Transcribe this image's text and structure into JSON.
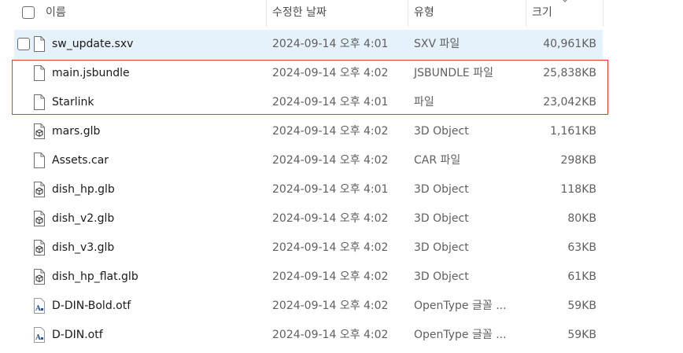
{
  "header": {
    "name_label": "이름",
    "date_label": "수정한 날짜",
    "type_label": "유형",
    "size_label": "크기"
  },
  "files": [
    {
      "name": "sw_update.sxv",
      "date": "2024-09-14 오후 4:01",
      "type": "SXV 파일",
      "size": "40,961KB",
      "icon": "file-icon",
      "selected": true
    },
    {
      "name": "main.jsbundle",
      "date": "2024-09-14 오후 4:02",
      "type": "JSBUNDLE 파일",
      "size": "25,838KB",
      "icon": "file-icon"
    },
    {
      "name": "Starlink",
      "date": "2024-09-14 오후 4:01",
      "type": "파일",
      "size": "23,042KB",
      "icon": "file-icon"
    },
    {
      "name": "mars.glb",
      "date": "2024-09-14 오후 4:02",
      "type": "3D Object",
      "size": "1,161KB",
      "icon": "3d-object-icon"
    },
    {
      "name": "Assets.car",
      "date": "2024-09-14 오후 4:02",
      "type": "CAR 파일",
      "size": "298KB",
      "icon": "file-icon"
    },
    {
      "name": "dish_hp.glb",
      "date": "2024-09-14 오후 4:01",
      "type": "3D Object",
      "size": "118KB",
      "icon": "3d-object-icon"
    },
    {
      "name": "dish_v2.glb",
      "date": "2024-09-14 오후 4:02",
      "type": "3D Object",
      "size": "80KB",
      "icon": "3d-object-icon"
    },
    {
      "name": "dish_v3.glb",
      "date": "2024-09-14 오후 4:02",
      "type": "3D Object",
      "size": "63KB",
      "icon": "3d-object-icon"
    },
    {
      "name": "dish_hp_flat.glb",
      "date": "2024-09-14 오후 4:02",
      "type": "3D Object",
      "size": "61KB",
      "icon": "3d-object-icon"
    },
    {
      "name": "D-DIN-Bold.otf",
      "date": "2024-09-14 오후 4:02",
      "type": "OpenType 글꼴 ...",
      "size": "59KB",
      "icon": "font-file-icon"
    },
    {
      "name": "D-DIN.otf",
      "date": "2024-09-14 오후 4:02",
      "type": "OpenType 글꼴 ...",
      "size": "59KB",
      "icon": "font-file-icon"
    }
  ],
  "colors": {
    "selection": "#e5f1fb",
    "highlight_border": "#e53935"
  }
}
